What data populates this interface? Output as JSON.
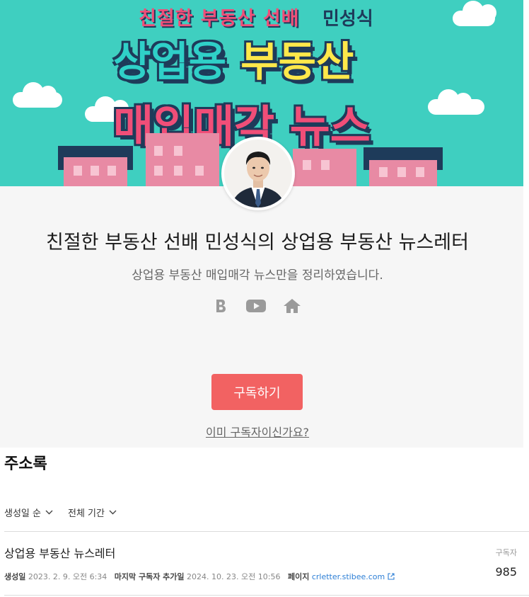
{
  "banner": {
    "top_text": "친절한 부동산 선배",
    "author_name": "민성식",
    "line1_a": "상업용",
    "line1_b": "부동산",
    "line2": "매입매각 뉴스"
  },
  "profile": {
    "title": "친절한 부동산 선배 민성식의 상업용 부동산 뉴스레터",
    "subtitle": "상업용 부동산 매입매각 뉴스만을 정리하였습니다.",
    "social_icons": [
      "blog-b-icon",
      "youtube-icon",
      "home-icon"
    ],
    "subscribe_label": "구독하기",
    "already_subscriber_label": "이미 구독자이신가요?"
  },
  "colors": {
    "banner_bg": "#3fcfc0",
    "accent_pink": "#f04e78",
    "subscribe_button": "#f26262",
    "link": "#2d7fd6"
  },
  "address_book": {
    "title": "주소록",
    "sort_label": "생성일 순",
    "period_label": "전체 기간",
    "list": [
      {
        "name": "상업용 부동산 뉴스레터",
        "created_label": "생성일",
        "created_value": "2023. 2. 9. 오전 6:34",
        "last_added_label": "마지막 구독자 추가일",
        "last_added_value": "2024. 10. 23. 오전 10:56",
        "page_label": "페이지",
        "page_value": "crletter.stibee.com",
        "subscribers_label": "구독자",
        "subscribers_value": "985"
      }
    ]
  }
}
